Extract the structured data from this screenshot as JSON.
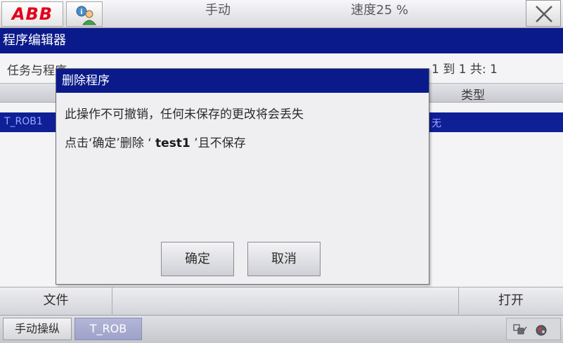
{
  "header": {
    "brand": "ABB",
    "mode": "手动",
    "speed": "速度25 %"
  },
  "window": {
    "title": "程序编辑器"
  },
  "main": {
    "task_label": "任务与程序",
    "count_label": "1 到 1 共: 1",
    "columns": {
      "type": "类型"
    },
    "selected_row": {
      "task": "T_ROB1",
      "type": "无"
    }
  },
  "commands": {
    "file": "文件",
    "open": "打开"
  },
  "taskbar": {
    "manual": "手动操纵",
    "rob": "T_ROB"
  },
  "dialog": {
    "title": "删除程序",
    "line1": "此操作不可撤销，任何未保存的更改将会丢失",
    "line2_prefix": "点击‘确定’删除 ‘ ",
    "program_name": "test1",
    "line2_suffix": " ’且不保存",
    "ok_label": "确定",
    "cancel_label": "取消"
  },
  "colors": {
    "title_bar": "#0b1a8a",
    "abb_red": "#e2001a",
    "selection": "#0f1f95"
  }
}
